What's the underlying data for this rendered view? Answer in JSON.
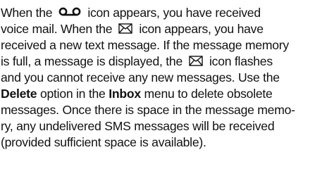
{
  "paragraph": {
    "l1_a": "When the",
    "l1_b": "icon appears, you have received",
    "l2_a": "voice mail. When the",
    "l2_b": "icon appears, you have",
    "l3": "received a new text message. If the message memory",
    "l4_a": "is full, a message is displayed, the",
    "l4_b": "icon flashes",
    "l5_a": "and you cannot receive any new messages. Use the",
    "l6_bold1": "Delete",
    "l6_mid": " option in the ",
    "l6_bold2": "Inbox",
    "l6_end": " menu to delete obsolete",
    "l7": "messages. Once there is space in the message memo-",
    "l8": "ry, any undelivered SMS messages will be received",
    "l9": "(provided sufficient space is available)."
  },
  "icons": {
    "voicemail": "voicemail-icon",
    "envelope": "envelope-icon"
  },
  "colors": {
    "text": "#111111",
    "background": "#ffffff"
  }
}
